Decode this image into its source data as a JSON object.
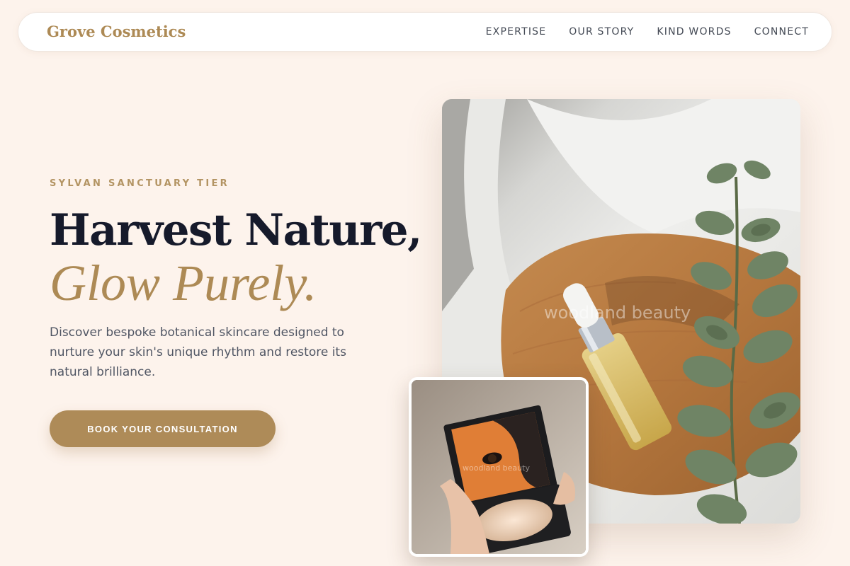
{
  "brand": {
    "name": "Grove Cosmetics"
  },
  "nav": {
    "items": [
      {
        "label": "EXPERTISE"
      },
      {
        "label": "OUR STORY"
      },
      {
        "label": "KIND WORDS"
      },
      {
        "label": "CONNECT"
      }
    ]
  },
  "hero": {
    "eyebrow": "SYLVAN SANCTUARY TIER",
    "headline_line1": "Harvest Nature,",
    "headline_line2": "Glow Purely.",
    "lead": "Discover bespoke botanical skincare designed to nurture your skin's unique rhythm and restore its natural brilliance.",
    "cta_label": "BOOK YOUR CONSULTATION"
  },
  "images": {
    "main_watermark": "woodland beauty",
    "inset_watermark": "woodland beauty",
    "main_alt_icon": "serum-bottle-photo",
    "inset_alt_icon": "compact-mirror-photo"
  },
  "colors": {
    "background": "#fdf3ec",
    "accent": "#ae8b58",
    "heading": "#161a2b"
  }
}
